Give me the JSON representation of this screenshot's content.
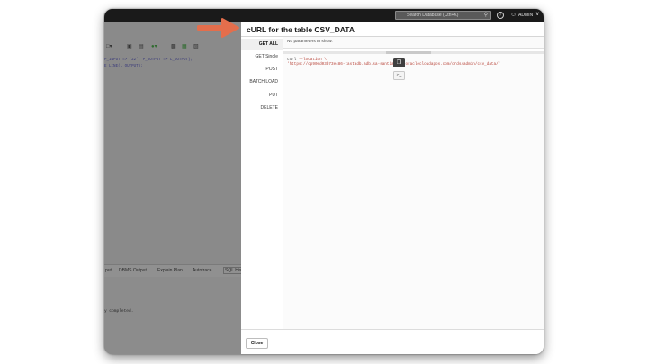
{
  "header": {
    "search_placeholder": "Search Database (Ctrl+K)",
    "help_glyph": "?",
    "user_glyph": "☺",
    "user_label": "ADMIN",
    "chevron_glyph": "∨"
  },
  "editor": {
    "code_lines": [
      "P_INPUT => '22', P_OUTPUT => L_OUTPUT);",
      "E_LINE(L_OUTPUT);"
    ],
    "bottom_tabs": [
      "put",
      "DBMS Output",
      "Explain Plan",
      "Autotrace",
      "SQL Hist"
    ],
    "output_text": "y completed."
  },
  "modal": {
    "title": "cURL for the table CSV_DATA",
    "nav": [
      "GET ALL",
      "GET Single",
      "POST",
      "BATCH LOAD",
      "PUT",
      "DELETE"
    ],
    "active_nav": "GET ALL",
    "params_text": "No parameters to show.",
    "curl_line1_cmd": "curl ",
    "curl_line1_flag": "--location \\",
    "curl_line2": "'https://cp90ed03b73e486-tastadb.adb.sa-santiago-1.oraclecloudapps.com/ords/admin/csv_data/'",
    "copy_glyph": "❐",
    "terminal_glyph": ">_",
    "close_label": "Close"
  },
  "colors": {
    "arrow": "#e46e4c",
    "curl_text": "#b8453a"
  }
}
